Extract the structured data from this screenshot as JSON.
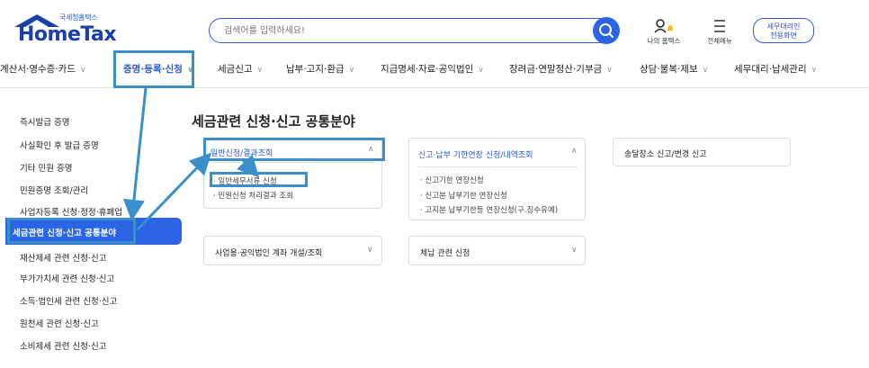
{
  "header": {
    "logo_sub": "국세청홈택스",
    "logo_main": "HomeTax",
    "search_placeholder": "검색어를 입력하세요!",
    "my_hometax": "나의 홈택스",
    "all_menu": "전체메뉴",
    "proxy_line1": "세무대리인",
    "proxy_line2": "전용화면"
  },
  "gnb": [
    {
      "label": "계산서·영수증·카드"
    },
    {
      "label": "증명·등록·신청"
    },
    {
      "label": "세금신고"
    },
    {
      "label": "납부·고지·환급"
    },
    {
      "label": "지급명세·자료·공익법인"
    },
    {
      "label": "장려금·연말정산·기부금"
    },
    {
      "label": "상담·불복·제보"
    },
    {
      "label": "세무대리·납세관리"
    }
  ],
  "sidebar": [
    {
      "label": "즉시발급 증명"
    },
    {
      "label": "사실확인 후 발급 증명"
    },
    {
      "label": "기타 민원 증명"
    },
    {
      "label": "민원증명 조회/관리"
    },
    {
      "label": "사업자등록 신청·정정·휴폐업"
    },
    {
      "label": "세금관련 신청·신고 공통분야"
    },
    {
      "label": "재산제세 관련 신청·신고"
    },
    {
      "label": "부가가치세 관련 신청·신고"
    },
    {
      "label": "소득·법인세 관련 신청·신고"
    },
    {
      "label": "원천세 관련 신청·신고"
    },
    {
      "label": "소비제세 관련 신청·신고"
    }
  ],
  "main": {
    "title": "세금관련 신청·신고 공통분야",
    "cards": [
      {
        "title": "일반신청/결과조회",
        "items": [
          "일반세무서류 신청",
          "민원신청 처리결과 조회"
        ]
      },
      {
        "title": "신고·납부 기한연장 신청/내역조회",
        "items": [
          "신고기한 연장신청",
          "신고분 납부기한 연장신청",
          "고지분 납부기한등 연장신청(구.징수유예)"
        ]
      },
      {
        "title": "송달장소 신고/변경 신고",
        "items": []
      },
      {
        "title": "사업용·공익법인 계좌 개설/조회",
        "items": []
      },
      {
        "title": "체납 관련 신청",
        "items": []
      }
    ]
  },
  "colors": {
    "accent": "#2c64e6",
    "highlight": "#3a8ec9"
  }
}
